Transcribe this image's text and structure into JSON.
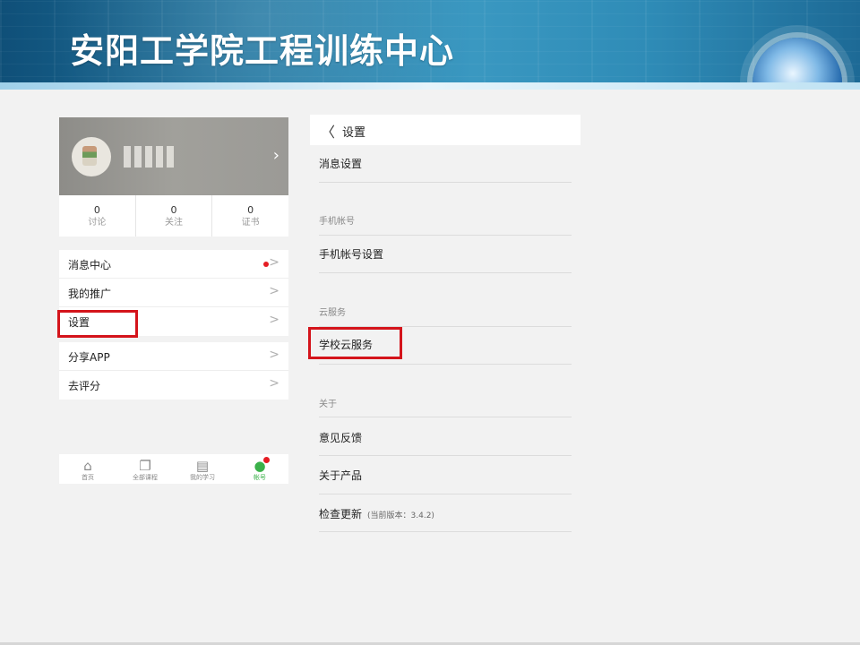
{
  "banner": {
    "title": "安阳工学院工程训练中心"
  },
  "profile": {
    "chevron": "›"
  },
  "stats": [
    {
      "count": "0",
      "label": "讨论"
    },
    {
      "count": "0",
      "label": "关注"
    },
    {
      "count": "0",
      "label": "证书"
    }
  ],
  "menu_group_1": [
    {
      "label": "消息中心"
    },
    {
      "label": "我的推广"
    },
    {
      "label": "设置"
    }
  ],
  "menu_group_2": [
    {
      "label": "分享APP"
    },
    {
      "label": "去评分"
    }
  ],
  "tabbar": [
    {
      "label": "首页",
      "icon": "home-icon"
    },
    {
      "label": "全部课程",
      "icon": "courses-icon"
    },
    {
      "label": "我的学习",
      "icon": "book-icon"
    },
    {
      "label": "帐号",
      "icon": "account-icon"
    }
  ],
  "settings": {
    "title": "设置",
    "back_glyph": "〈",
    "rows": {
      "message_settings": "消息设置",
      "section_phone": "手机帐号",
      "phone_settings": "手机帐号设置",
      "section_cloud": "云服务",
      "school_cloud": "学校云服务",
      "section_about": "关于",
      "feedback": "意见反馈",
      "about_product": "关于产品",
      "check_update": "检查更新",
      "version_note": "(当前版本：3.4.2)"
    }
  },
  "colors": {
    "highlight": "#d4141b",
    "active_tab": "#3bb14a",
    "badge": "#e51c23"
  }
}
